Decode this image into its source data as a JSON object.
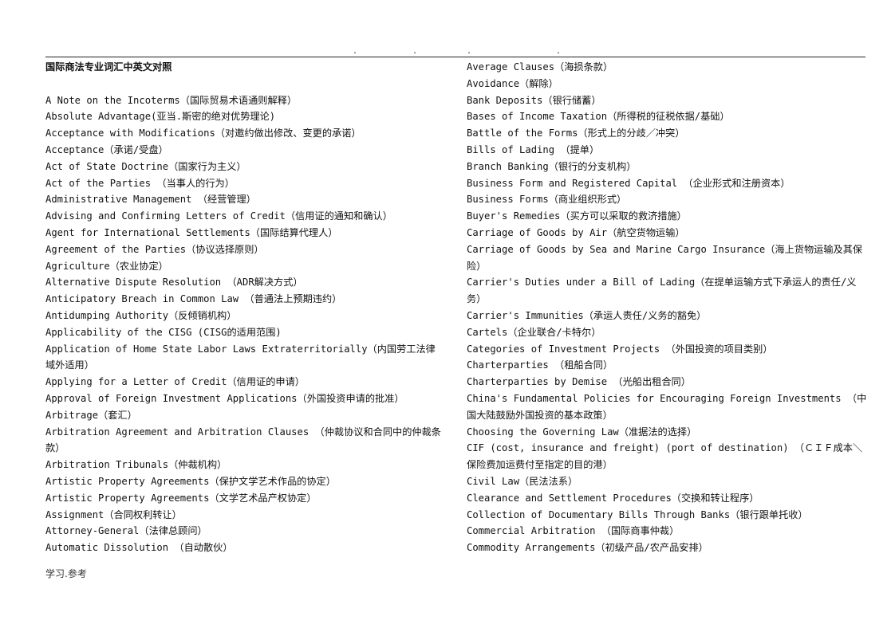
{
  "header": {
    "dots": [
      ".",
      ".",
      ".",
      "."
    ]
  },
  "document": {
    "title": "国际商法专业词汇中英文对照",
    "left_entries": [
      "A Note on the Incoterms（国际贸易术语通则解释）",
      "Absolute Advantage(亚当.斯密的绝对优势理论)",
      "Acceptance with Modifications（对邀约做出修改、变更的承诺）",
      "Acceptance（承诺/受盘）",
      "Act of State Doctrine（国家行为主义）",
      "Act of the Parties （当事人的行为）",
      "Administrative Management （经营管理）",
      "Advising and Confirming Letters of Credit（信用证的通知和确认）",
      "Agent for International Settlements（国际结算代理人）",
      "Agreement of the Parties（协议选择原则）",
      "Agriculture（农业协定）",
      "Alternative Dispute Resolution （ADR解决方式）",
      "Anticipatory Breach in Common Law （普通法上预期违约）",
      "Antidumping Authority（反倾销机构）",
      "Applicability of the CISG (CISG的适用范围)",
      "Application of Home State Labor Laws Extraterritorially（内国劳工法律域外适用）",
      "Applying for a Letter of Credit（信用证的申请）",
      "Approval of Foreign Investment Applications（外国投资申请的批准）",
      "Arbitrage（套汇）",
      "Arbitration Agreement and Arbitration Clauses （仲裁协议和合同中的仲裁条款）",
      "Arbitration Tribunals（仲裁机构）",
      "Artistic Property Agreements（保护文学艺术作品的协定）",
      "Artistic Property Agreements（文学艺术品产权协定）",
      "Assignment（合同权利转让）",
      "Attorney-General（法律总顾问）",
      "Automatic Dissolution （自动散伙）"
    ],
    "right_entries": [
      "Average Clauses（海损条款）",
      "Avoidance（解除）",
      "Bank Deposits（银行储蓄）",
      "Bases of Income Taxation（所得税的征税依据/基础）",
      "Battle of the Forms（形式上的分歧／冲突）",
      "Bills of Lading （提单）",
      "Branch Banking（银行的分支机构）",
      "Business Form and Registered Capital （企业形式和注册资本）",
      "Business Forms（商业组织形式）",
      "Buyer's Remedies（买方可以采取的救济措施）",
      "Carriage of Goods by Air（航空货物运输）",
      "Carriage of Goods by Sea and Marine Cargo Insurance（海上货物运输及其保险）",
      "Carrier's Duties under a Bill of Lading（在提单运输方式下承运人的责任/义务）",
      "Carrier's Immunities（承运人责任/义务的豁免）",
      "Cartels（企业联合/卡特尔）",
      "Categories of Investment Projects （外国投资的项目类别）",
      "Charterparties （租船合同）",
      "Charterparties by Demise （光船出租合同）",
      "China's Fundamental Policies for Encouraging Foreign Investments （中国大陆鼓励外国投资的基本政策）",
      "Choosing the Governing Law（准据法的选择）",
      "CIF (cost, insurance and freight) (port of destination) （ＣＩＦ成本＼保险费加运费付至指定的目的港）",
      "Civil Law（民法法系）",
      "Clearance and Settlement Procedures（交换和转让程序）",
      "Collection of Documentary Bills Through Banks（银行跟单托收）",
      "Commercial Arbitration （国际商事仲裁）",
      "Commodity Arrangements（初级产品/农产品安排）"
    ]
  },
  "footer": {
    "text": "学习.参考"
  }
}
